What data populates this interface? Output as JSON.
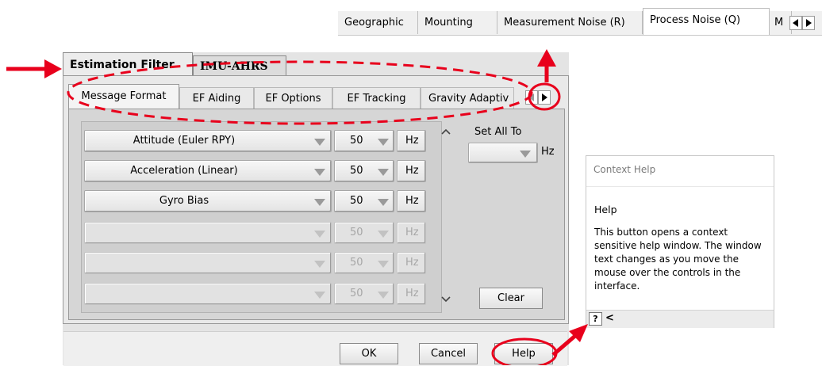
{
  "top_tabs": {
    "items": [
      "Geographic",
      "Mounting",
      "Measurement Noise (R)",
      "Process Noise (Q)",
      "M"
    ],
    "selected": "Process Noise (Q)"
  },
  "outer_tabs": {
    "items": [
      "Estimation Filter",
      "IMU-AHRS"
    ],
    "selected": "Estimation Filter"
  },
  "inner_tabs": {
    "items": [
      "Message Format",
      "EF Aiding",
      "EF Options",
      "EF Tracking",
      "Gravity Adaptiv"
    ],
    "selected": "Message Format"
  },
  "rows": [
    {
      "message": "Attitude (Euler RPY)",
      "rate": "50",
      "unit": "Hz",
      "enabled": true
    },
    {
      "message": "Acceleration (Linear)",
      "rate": "50",
      "unit": "Hz",
      "enabled": true
    },
    {
      "message": "Gyro Bias",
      "rate": "50",
      "unit": "Hz",
      "enabled": true
    },
    {
      "message": "",
      "rate": "50",
      "unit": "Hz",
      "enabled": false
    },
    {
      "message": "",
      "rate": "50",
      "unit": "Hz",
      "enabled": false
    },
    {
      "message": "",
      "rate": "50",
      "unit": "Hz",
      "enabled": false
    }
  ],
  "set_all": {
    "label": "Set All To",
    "unit": "Hz",
    "value": ""
  },
  "buttons": {
    "clear": "Clear",
    "ok": "OK",
    "cancel": "Cancel",
    "help": "Help"
  },
  "context_help": {
    "title": "Context Help",
    "subtitle": "Help",
    "body": "This button opens a context sensitive help window.  The window text changes as you move the mouse over the controls in the interface.",
    "question_icon": "?",
    "back_glyph": "<"
  },
  "annotation_color": "#e8001c"
}
